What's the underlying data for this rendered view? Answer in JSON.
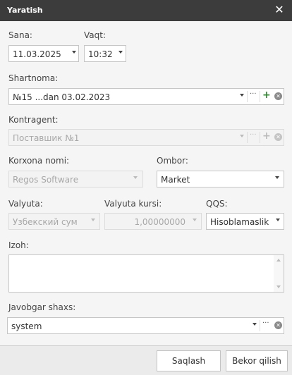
{
  "window": {
    "title": "Yaratish",
    "close_icon": "close-icon"
  },
  "form": {
    "sana": {
      "label": "Sana:",
      "value": "11.03.2025"
    },
    "vaqt": {
      "label": "Vaqt:",
      "value": "10:32"
    },
    "shartnoma": {
      "label": "Shartnoma:",
      "value": "№15 ...dan 03.02.2023"
    },
    "kontragent": {
      "label": "Kontragent:",
      "value": "Поставшик №1"
    },
    "korxona": {
      "label": "Korxona nomi:",
      "value": "Regos Software"
    },
    "ombor": {
      "label": "Ombor:",
      "value": "Market"
    },
    "valyuta": {
      "label": "Valyuta:",
      "value": "Узбекский сум"
    },
    "valyuta_kursi": {
      "label": "Valyuta kursi:",
      "value": "1,00000000"
    },
    "qqs": {
      "label": "QQS:",
      "value": "Hisoblamaslik"
    },
    "izoh": {
      "label": "Izoh:",
      "value": ""
    },
    "javobgar": {
      "label": "Javobgar shaxs:",
      "value": "system"
    }
  },
  "buttons": {
    "save": "Saqlash",
    "cancel": "Bekor qilish"
  },
  "colors": {
    "titlebar": "#3c3c3c",
    "plus_icon": "#2e8b2e"
  }
}
